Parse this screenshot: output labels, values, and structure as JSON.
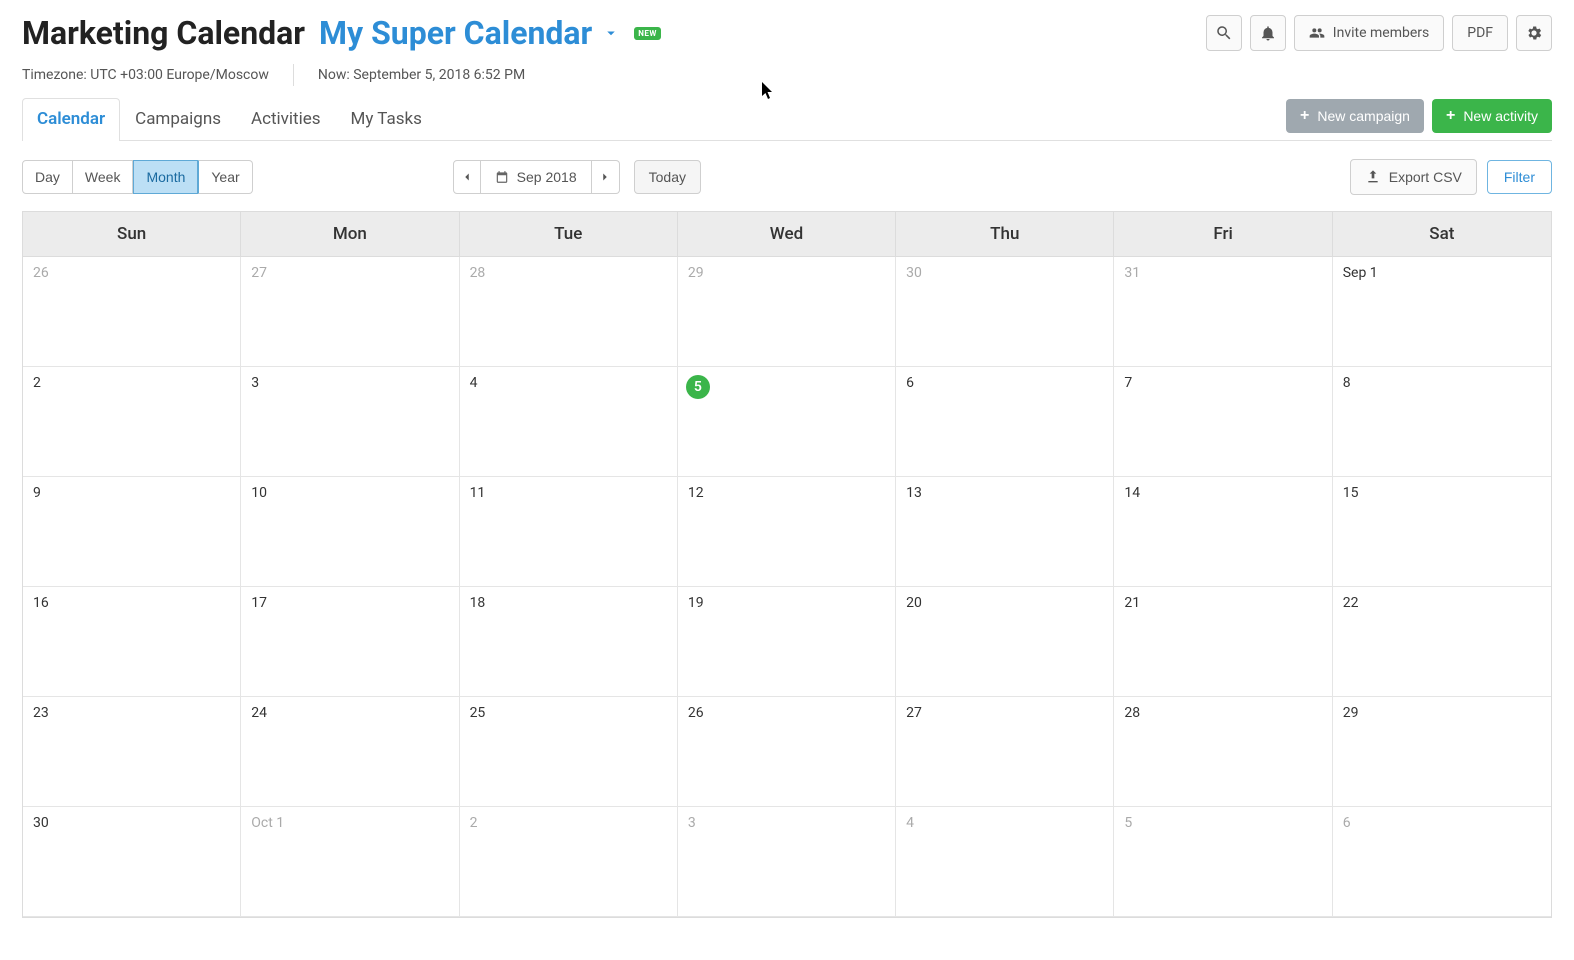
{
  "header": {
    "app_title": "Marketing Calendar",
    "calendar_name": "My Super Calendar",
    "new_badge": "NEW",
    "invite_label": "Invite members",
    "pdf_label": "PDF"
  },
  "subheader": {
    "timezone": "Timezone: UTC +03:00 Europe/Moscow",
    "now": "Now: September 5, 2018 6:52 PM"
  },
  "tabs": [
    "Calendar",
    "Campaigns",
    "Activities",
    "My Tasks"
  ],
  "active_tab": "Calendar",
  "action_buttons": {
    "new_campaign": "New campaign",
    "new_activity": "New activity"
  },
  "view_modes": [
    "Day",
    "Week",
    "Month",
    "Year"
  ],
  "active_view": "Month",
  "date_nav": {
    "label": "Sep 2018",
    "today_label": "Today"
  },
  "tools": {
    "export_label": "Export CSV",
    "filter_label": "Filter"
  },
  "weekdays": [
    "Sun",
    "Mon",
    "Tue",
    "Wed",
    "Thu",
    "Fri",
    "Sat"
  ],
  "weeks": [
    [
      {
        "label": "26",
        "outside": true
      },
      {
        "label": "27",
        "outside": true
      },
      {
        "label": "28",
        "outside": true
      },
      {
        "label": "29",
        "outside": true
      },
      {
        "label": "30",
        "outside": true
      },
      {
        "label": "31",
        "outside": true
      },
      {
        "label": "Sep 1",
        "outside": false
      }
    ],
    [
      {
        "label": "2"
      },
      {
        "label": "3"
      },
      {
        "label": "4"
      },
      {
        "label": "5",
        "today": true
      },
      {
        "label": "6"
      },
      {
        "label": "7"
      },
      {
        "label": "8"
      }
    ],
    [
      {
        "label": "9"
      },
      {
        "label": "10"
      },
      {
        "label": "11"
      },
      {
        "label": "12"
      },
      {
        "label": "13"
      },
      {
        "label": "14"
      },
      {
        "label": "15"
      }
    ],
    [
      {
        "label": "16"
      },
      {
        "label": "17"
      },
      {
        "label": "18"
      },
      {
        "label": "19"
      },
      {
        "label": "20"
      },
      {
        "label": "21"
      },
      {
        "label": "22"
      }
    ],
    [
      {
        "label": "23"
      },
      {
        "label": "24"
      },
      {
        "label": "25"
      },
      {
        "label": "26"
      },
      {
        "label": "27"
      },
      {
        "label": "28"
      },
      {
        "label": "29"
      }
    ],
    [
      {
        "label": "30"
      },
      {
        "label": "Oct 1",
        "outside": true
      },
      {
        "label": "2",
        "outside": true
      },
      {
        "label": "3",
        "outside": true
      },
      {
        "label": "4",
        "outside": true
      },
      {
        "label": "5",
        "outside": true
      },
      {
        "label": "6",
        "outside": true
      }
    ]
  ]
}
